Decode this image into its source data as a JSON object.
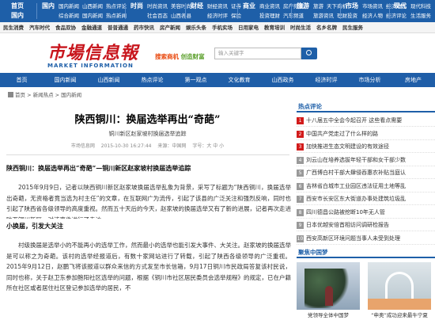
{
  "topnav": {
    "home": [
      "首页",
      "国内"
    ],
    "groups": [
      {
        "big": "国内",
        "row1": [
          "国内新闻",
          "山西新闻",
          "热点评论"
        ],
        "row2": [
          "综合新闻",
          "国内新闻",
          "热点新闻"
        ]
      },
      {
        "big": "时尚",
        "row1": [
          "时尚资讯",
          "美容时尚"
        ],
        "row2": [
          "社会百态",
          "山西各县"
        ]
      },
      {
        "big": "财经",
        "row1": [
          "财经资讯",
          "证券"
        ],
        "row2": [
          "经济时评",
          "保险"
        ]
      },
      {
        "big": "商业",
        "row1": [
          "商业资讯",
          "房产频道"
        ],
        "row2": [
          "投资理财",
          "汽车频道"
        ]
      },
      {
        "big": "旅游",
        "row1": [
          "旅游",
          "天下商机"
        ],
        "row2": [
          "旅游资讯",
          "理财投资"
        ]
      },
      {
        "big": "市场",
        "row1": [
          "市场资讯",
          "经济动态"
        ],
        "row2": [
          "经济人物",
          "经济评论"
        ]
      },
      {
        "big": "现代",
        "row1": [
          "现代科技",
          "惠农政策"
        ],
        "row2": [
          "生活服务",
          "农业频道"
        ]
      }
    ]
  },
  "subnav": [
    "民生消费",
    "汽车时代",
    "食品双协",
    "金融通道",
    "普普通通",
    "药市快讯",
    "房产新闻",
    "娱乐头条",
    "手机实场",
    "日用家电",
    "教育培训",
    "时尚生活",
    "名乡名牌",
    "民生服务"
  ],
  "logo": {
    "cn": "市場信息報",
    "en": "MARKET INFORMATION"
  },
  "slogan": {
    "a": "搜索商机",
    "b": "创造财富"
  },
  "search": {
    "placeholder": "输入关键字"
  },
  "mainnav": [
    "首页",
    "国内新闻",
    "山西新闻",
    "热点评论",
    "第一观点",
    "文化教育",
    "山西政务",
    "经济时评",
    "市场分析",
    "房地产"
  ],
  "breadcrumb": "首页 > 新闻热点 > 国内新闻",
  "article": {
    "title": "陕西铜川：换届选举再出“奇葩”",
    "subtitle": "铜川新区赵家坡村换届选举追踪",
    "meta": [
      "市场信息网",
      "2015-10-30 16:27:44",
      "来源：中国网",
      "字号：大 中 小"
    ],
    "lead": "陕西铜川：换届选举再出“奇葩”—铜川新区赵家坡村换届选举追踪",
    "p1": "2015年9月9日，记者以陕西铜川新区赵家坡换届选举乱象为背景，采写了标题为“陕西铜川，换届选举出奇葩，无资格者竟当选为村主任”的文章，在互联网广为流传，引起了该县的广泛关注和强烈反响，同时也引起了陕西省各级领导的高度重视。然而五十天后的今天，赵家坡的换届选举又有了新的进展，记者再次走进陕西铜川新区，对该事件进行了走访。",
    "sub1": "小换届，引发大关注",
    "p2": "村级换届是选举小的不能再小的选举工作，然而最小的选举也能引发大事件、大关注。赵家坡的换届选举是可以称之为奇葩。该村的选举经报道后，有数十家网站进行了转载，引起了陕西各级领导的广泛重视。2015年9月12日，赵鹏飞将该报道以群众来信的方式发至市长信箱，9月17日铜川市民政局答复该村民说，同时也称，关于赵卫东参加鲍阳社区选举的问题，根据《铜川市社区居民委员会选举规程》的规定，已在户籍所在社区或者居住社区登记参加选举的居民，不"
  },
  "sidebar": {
    "hot_title": "热点评论",
    "hot": [
      "十八届五中全会今起召开 这些看点需要",
      "中国共产党走过了什么样的路",
      "加快推进生态文明建设的有效途径",
      "刘云山在培养选拔年轻干部和女干部少数",
      "广西博白村干部大肆侵吞惠农补贴当庭认",
      "吉林省白城市工业园区违法征用土地等乱",
      "西安市长安区东大街道办事处建筑垃圾乱",
      "四川德昌公路被挖断10年无人管",
      "日本优越安倍首相访问调研检报告",
      "西安高新区环境问题当事人未受到处理"
    ],
    "cq_title": "聚焦中国梦",
    "cap1": "党领导全体中国梦",
    "cap2": "“申奥”成功迎来最牛宁夏"
  }
}
